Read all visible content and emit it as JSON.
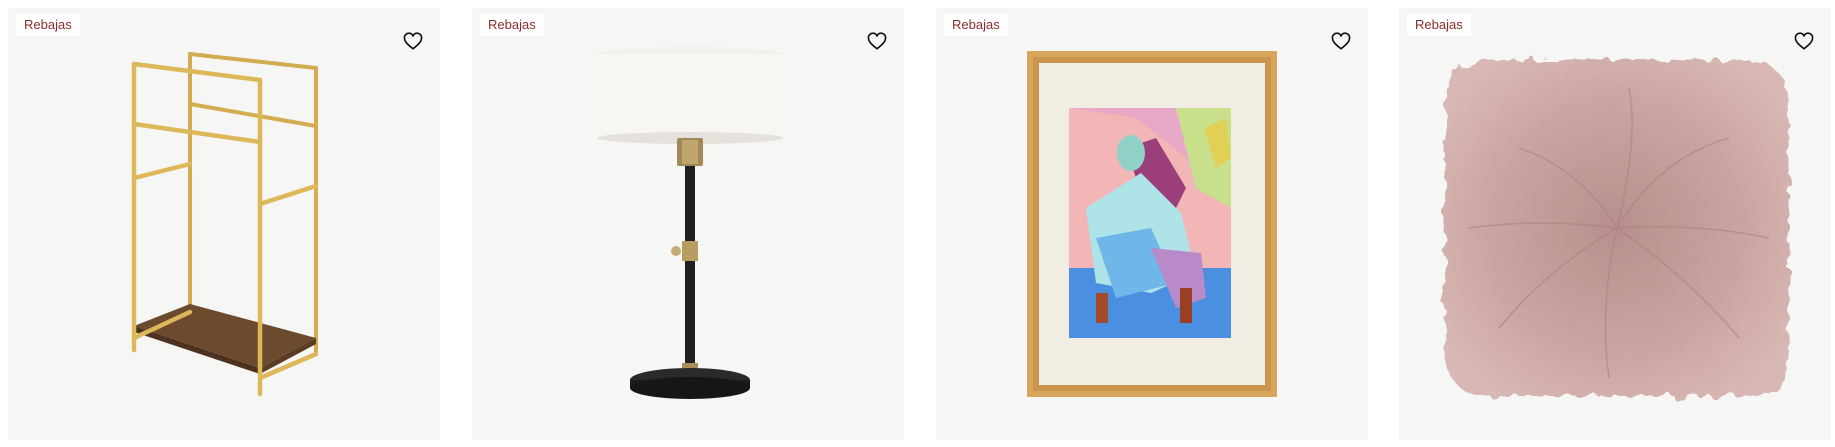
{
  "products": [
    {
      "badge": "Rebajas",
      "image_icon": "towel-rack-image",
      "favorite_icon": "heart-outline-icon"
    },
    {
      "badge": "Rebajas",
      "image_icon": "table-lamp-image",
      "favorite_icon": "heart-outline-icon"
    },
    {
      "badge": "Rebajas",
      "image_icon": "framed-art-print-image",
      "favorite_icon": "heart-outline-icon"
    },
    {
      "badge": "Rebajas",
      "image_icon": "sheepskin-cushion-image",
      "favorite_icon": "heart-outline-icon"
    }
  ],
  "colors": {
    "card_bg": "#f6f6f5",
    "badge_text": "#8b2c2c",
    "brass": "#d4ab48",
    "wood": "#6b4a2e"
  }
}
